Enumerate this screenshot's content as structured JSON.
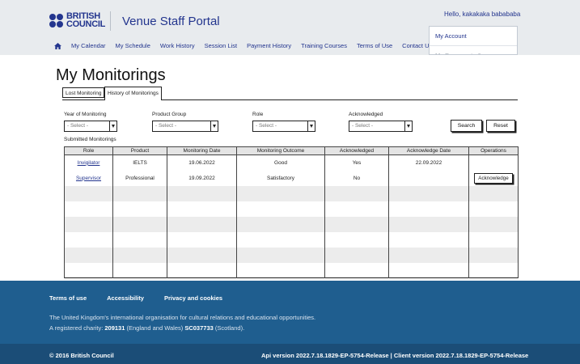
{
  "header": {
    "logo_line1": "BRITISH",
    "logo_line2": "COUNCIL",
    "portal_title": "Venue Staff Portal",
    "greeting": "Hello, kakakaka babababa",
    "nav": [
      "My Calendar",
      "My Schedule",
      "Work History",
      "Session List",
      "Payment History",
      "Training Courses",
      "Terms of Use",
      "Contact Us"
    ],
    "account_menu": [
      "My Account",
      "My Documents & Preferences"
    ]
  },
  "page": {
    "title": "My Monitorings",
    "tabs": [
      "Lost Monitoring",
      "History of Monitorings"
    ]
  },
  "filters": {
    "year_label": "Year of Monitoring",
    "product_label": "Product Group",
    "role_label": "Role",
    "ack_label": "Acknowledged",
    "select_placeholder": "- Select -",
    "search_label": "Search",
    "reset_label": "Reset"
  },
  "table": {
    "caption": "Submitted Monitorings",
    "headers": [
      "Role",
      "Product",
      "Monitoring Date",
      "Monitoring Outcome",
      "Acknowledged",
      "Acknowledge Date",
      "Operations"
    ],
    "rows": [
      {
        "role": "Invigilator",
        "product": "IELTS",
        "date": "19.06.2022",
        "outcome": "Good",
        "ack": "Yes",
        "ack_date": "22.09.2022",
        "op": ""
      },
      {
        "role": "Supervisor",
        "product": "Professional",
        "date": "19.09.2022",
        "outcome": "Satisfactory",
        "ack": "No",
        "ack_date": "",
        "op": "Acknowledge"
      }
    ]
  },
  "footer": {
    "links": [
      "Terms of use",
      "Accessibility",
      "Privacy and cookies"
    ],
    "text1": "The United Kingdom's international organisation for cultural relations and educational opportunities.",
    "text2_prefix": "A registered charity: ",
    "charity_number": "209131",
    "text2_mid": " (England and Wales) ",
    "scot_number": "SC037733",
    "text2_suffix": " (Scotland).",
    "copyright": "© 2016 British Council",
    "version": "Api version 2022.7.18.1829-EP-5754-Release | Client version 2022.7.18.1829-EP-5754-Release"
  },
  "colors": {
    "brand": "#23358e",
    "footer": "#1f5e8f",
    "subfooter": "#1b4d77",
    "header_bg": "#e8ebee"
  }
}
